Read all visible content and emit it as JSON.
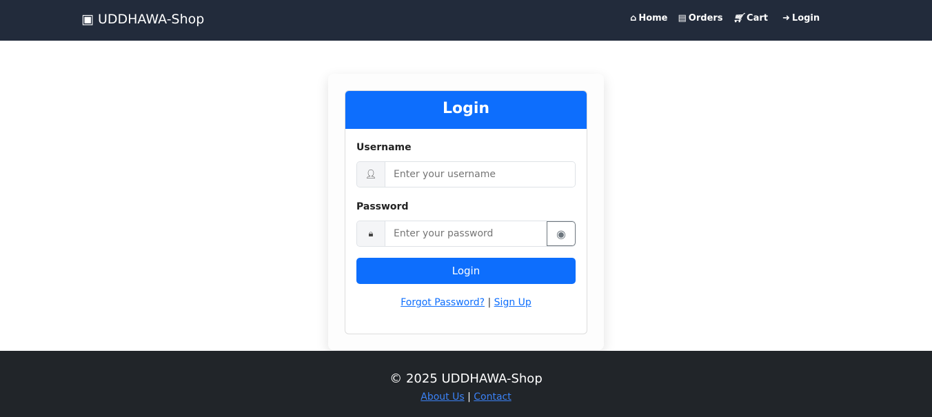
{
  "nav": {
    "brand": "UDDHAWA-Shop",
    "links": [
      {
        "label": "Home",
        "icon": "home-icon"
      },
      {
        "label": "Orders",
        "icon": "box-icon"
      },
      {
        "label": "Cart",
        "icon": "cart-icon"
      },
      {
        "label": "Login",
        "icon": "sign-in-icon"
      }
    ]
  },
  "login": {
    "title": "Login",
    "username_label": "Username",
    "username_placeholder": "Enter your username",
    "password_label": "Password",
    "password_placeholder": "Enter your password",
    "submit": "Login",
    "forgot": "Forgot Password?",
    "separator": "|",
    "signup": "Sign Up"
  },
  "footer": {
    "copyright": "© 2025 UDDHAWA-Shop",
    "about": "About Us",
    "separator": "|",
    "contact": "Contact"
  },
  "colors": {
    "nav": "#222b3b",
    "primary": "#0d6efd",
    "footer": "#212529"
  }
}
